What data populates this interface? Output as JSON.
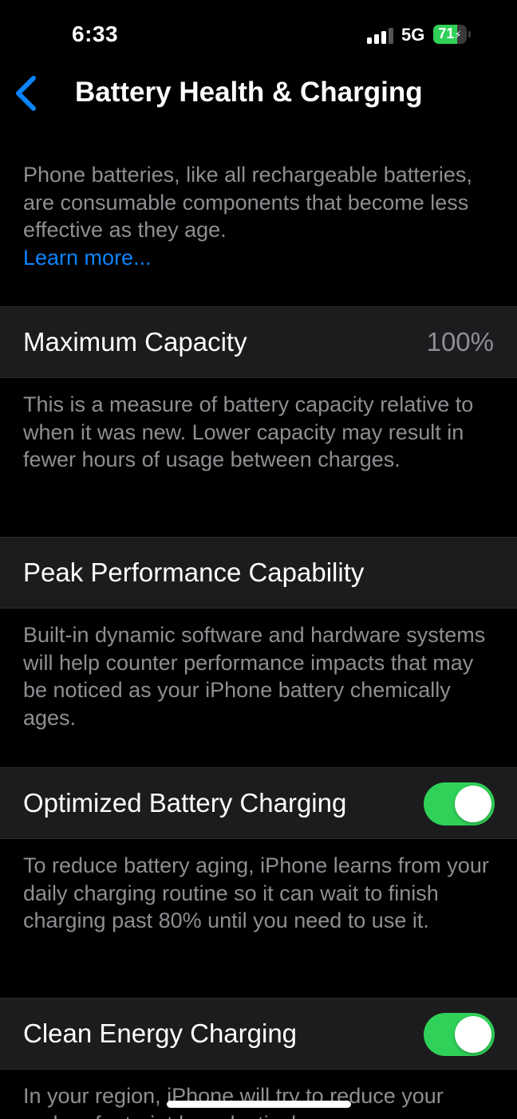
{
  "status_bar": {
    "time": "6:33",
    "network": "5G",
    "battery_percent": "71",
    "battery_level": 0.71,
    "battery_charging": true,
    "signal_bars_active": 3,
    "signal_bars_total": 4
  },
  "nav": {
    "title": "Battery Health & Charging",
    "back_icon": "chevron-left-icon"
  },
  "intro": {
    "text": "Phone batteries, like all rechargeable batteries, are consumable components that become less effective as they age.",
    "link": "Learn more..."
  },
  "maximum_capacity": {
    "label": "Maximum Capacity",
    "value": "100%",
    "footer": "This is a measure of battery capacity relative to when it was new. Lower capacity may result in fewer hours of usage between charges."
  },
  "peak_performance": {
    "label": "Peak Performance Capability",
    "footer": "Built-in dynamic software and hardware systems will help counter performance impacts that may be noticed as your iPhone battery chemically ages."
  },
  "optimized_charging": {
    "label": "Optimized Battery Charging",
    "enabled": true,
    "footer": "To reduce battery aging, iPhone learns from your daily charging routine so it can wait to finish charging past 80% until you need to use it."
  },
  "clean_energy": {
    "label": "Clean Energy Charging",
    "enabled": true,
    "footer": "In your region, iPhone will try to reduce your carbon footprint by selectively"
  },
  "colors": {
    "background": "#000000",
    "row_background": "#1c1c1e",
    "secondary_text": "#8e8e93",
    "accent_blue": "#0a84ff",
    "toggle_on": "#30d158"
  }
}
